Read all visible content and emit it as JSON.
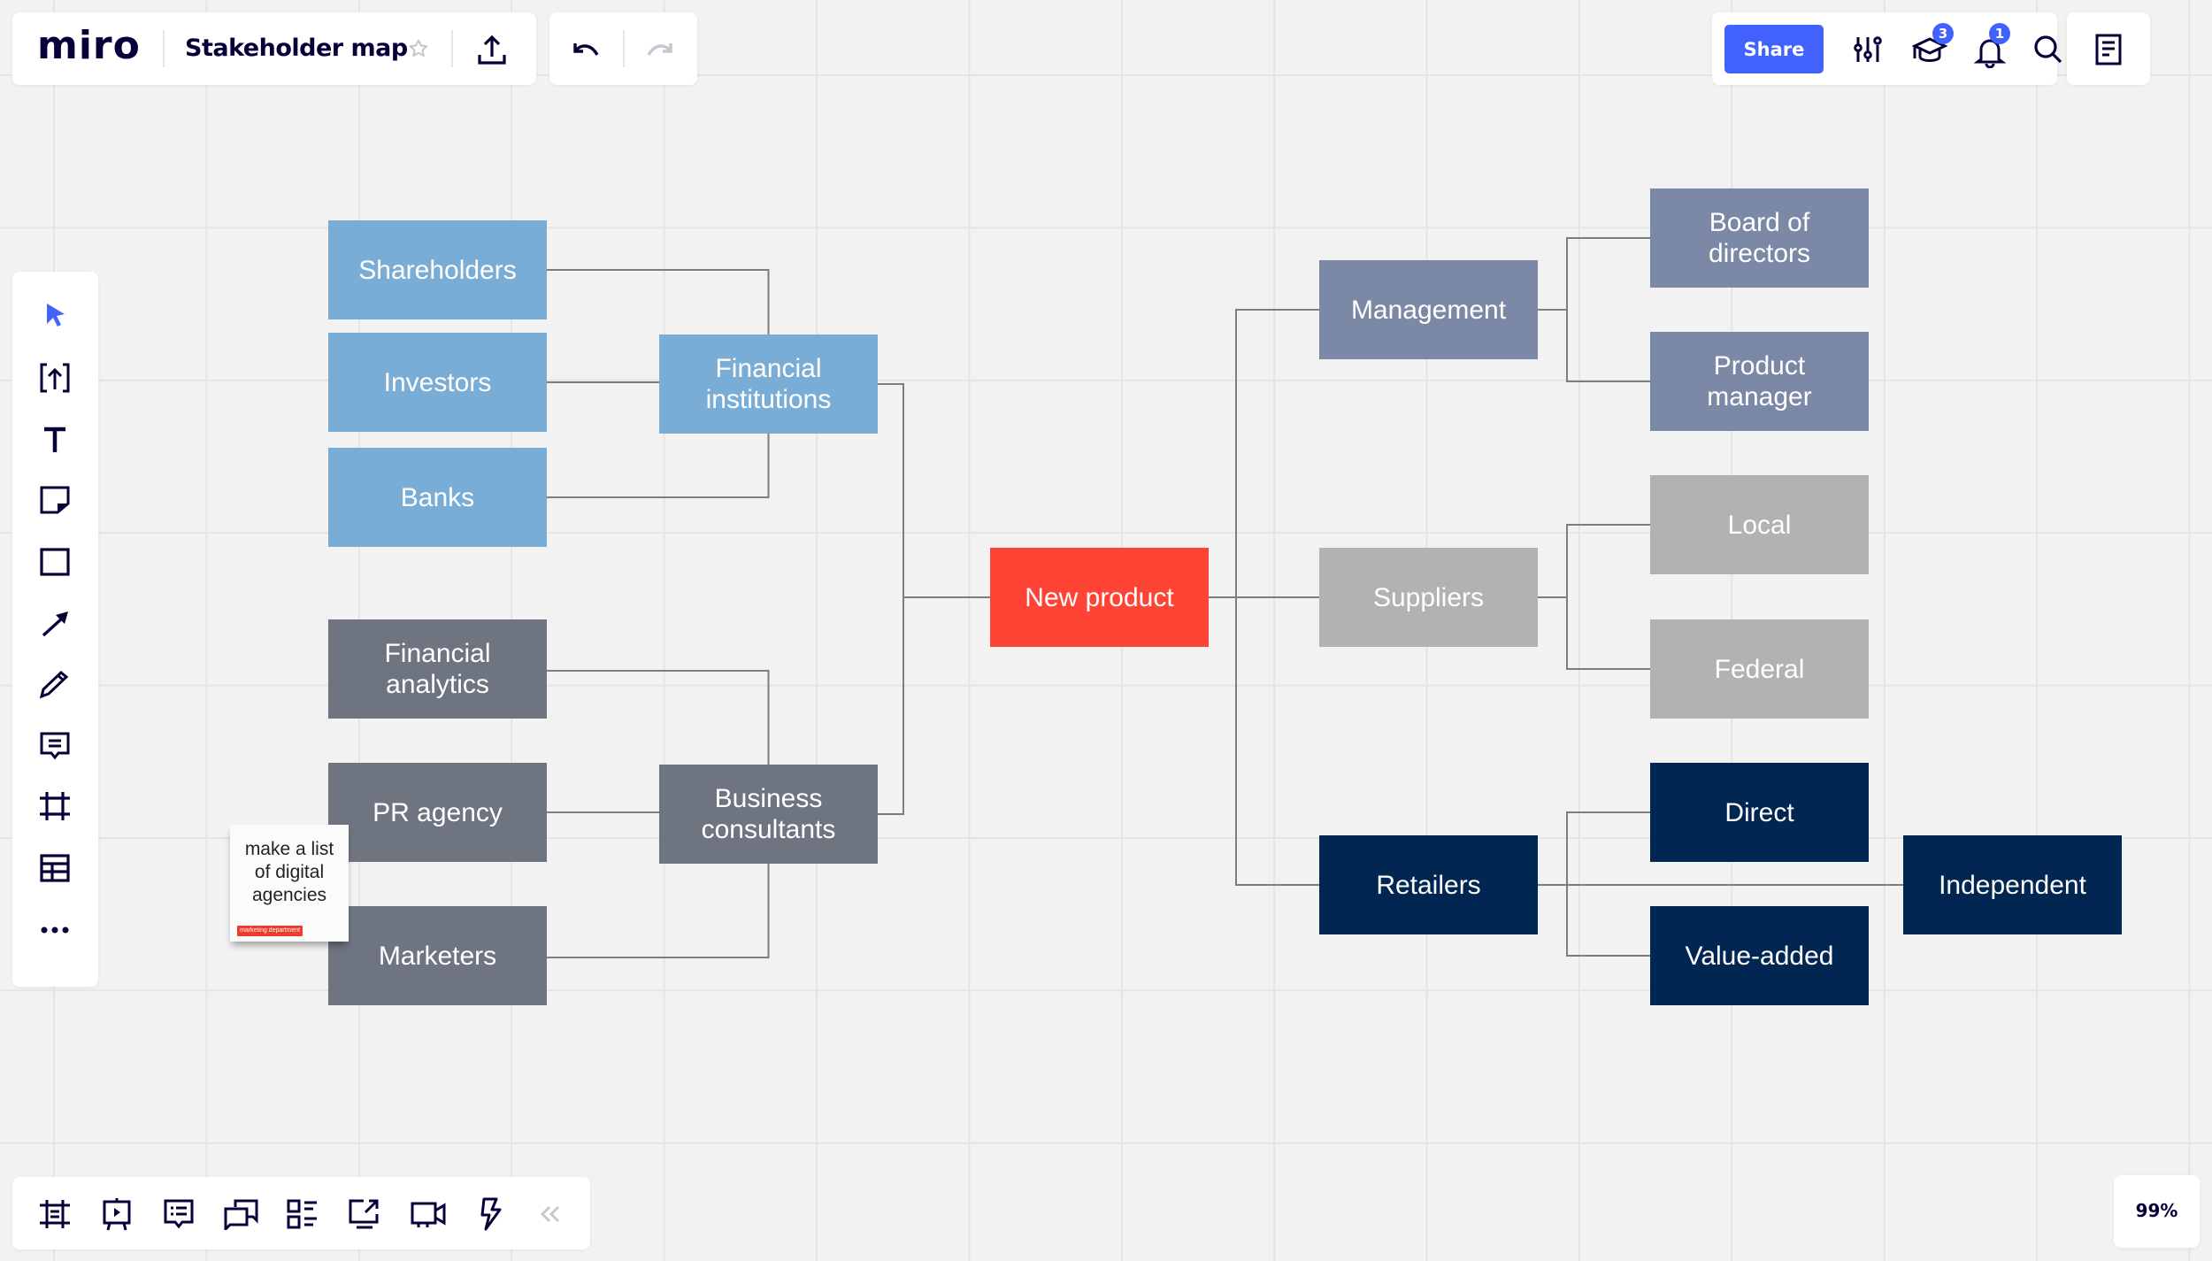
{
  "app": {
    "logo": "miro",
    "board_title": "Stakeholder map",
    "zoom_level": "99%"
  },
  "colors": {
    "accent": "#4262ff",
    "canvas": "#f2f2f2",
    "group_financial": "#7aadd6",
    "group_business": "#6f7580",
    "group_center": "#ff4335",
    "group_management": "#7b89a6",
    "group_suppliers": "#b2b2b2",
    "group_retailers": "#012651"
  },
  "top_left_toolbar": {
    "favorite_icon": "star-icon",
    "export_icon": "upload-icon",
    "undo_icon": "undo-icon",
    "redo_icon": "redo-icon"
  },
  "top_right_toolbar": {
    "share_label": "Share",
    "settings_icon": "sliders-icon",
    "learning_icon": "graduation-cap-icon",
    "learning_badge": "3",
    "notifications_icon": "bell-icon",
    "notifications_badge": "1",
    "search_icon": "search-icon",
    "board_menu_icon": "document-icon"
  },
  "left_toolbar": {
    "tools": [
      {
        "name": "select",
        "icon": "cursor-icon",
        "active": true
      },
      {
        "name": "upload",
        "icon": "upload-frame-icon"
      },
      {
        "name": "text",
        "icon": "text-icon"
      },
      {
        "name": "sticky-note",
        "icon": "sticky-note-icon"
      },
      {
        "name": "shape",
        "icon": "rectangle-icon"
      },
      {
        "name": "connection-line",
        "icon": "arrow-icon"
      },
      {
        "name": "pen",
        "icon": "pencil-icon"
      },
      {
        "name": "comment",
        "icon": "comment-icon"
      },
      {
        "name": "frame",
        "icon": "frame-icon"
      },
      {
        "name": "table",
        "icon": "table-icon"
      },
      {
        "name": "more",
        "icon": "more-icon"
      }
    ]
  },
  "bottom_toolbar": {
    "tools": [
      {
        "name": "frames",
        "icon": "frames-list-icon"
      },
      {
        "name": "presentation",
        "icon": "presentation-icon"
      },
      {
        "name": "comments",
        "icon": "comments-list-icon"
      },
      {
        "name": "chat",
        "icon": "chat-icon"
      },
      {
        "name": "cards",
        "icon": "cards-icon"
      },
      {
        "name": "screen-share",
        "icon": "screen-share-icon"
      },
      {
        "name": "video-call",
        "icon": "video-icon"
      },
      {
        "name": "activity",
        "icon": "lightning-icon"
      },
      {
        "name": "collapse",
        "icon": "double-chevron-left-icon"
      }
    ]
  },
  "diagram": {
    "nodes": [
      {
        "id": "shareholders",
        "label": "Shareholders",
        "group": "financial"
      },
      {
        "id": "investors",
        "label": "Investors",
        "group": "financial"
      },
      {
        "id": "banks",
        "label": "Banks",
        "group": "financial"
      },
      {
        "id": "financial_institutions",
        "label": "Financial\ninstitutions",
        "group": "financial"
      },
      {
        "id": "financial_analytics",
        "label": "Financial\nanalytics",
        "group": "business"
      },
      {
        "id": "pr_agency",
        "label": "PR agency",
        "group": "business"
      },
      {
        "id": "marketers",
        "label": "Marketers",
        "group": "business"
      },
      {
        "id": "business_consultants",
        "label": "Business\nconsultants",
        "group": "business"
      },
      {
        "id": "new_product",
        "label": "New product",
        "group": "center"
      },
      {
        "id": "management",
        "label": "Management",
        "group": "management"
      },
      {
        "id": "board_of_directors",
        "label": "Board of\ndirectors",
        "group": "management"
      },
      {
        "id": "product_manager",
        "label": "Product\nmanager",
        "group": "management"
      },
      {
        "id": "suppliers",
        "label": "Suppliers",
        "group": "suppliers"
      },
      {
        "id": "local",
        "label": "Local",
        "group": "suppliers"
      },
      {
        "id": "federal",
        "label": "Federal",
        "group": "suppliers"
      },
      {
        "id": "retailers",
        "label": "Retailers",
        "group": "retailers"
      },
      {
        "id": "direct",
        "label": "Direct",
        "group": "retailers"
      },
      {
        "id": "value_added",
        "label": "Value-added",
        "group": "retailers"
      },
      {
        "id": "independent",
        "label": "Independent",
        "group": "retailers"
      }
    ],
    "edges": [
      [
        "shareholders",
        "financial_institutions"
      ],
      [
        "investors",
        "financial_institutions"
      ],
      [
        "banks",
        "financial_institutions"
      ],
      [
        "financial_analytics",
        "business_consultants"
      ],
      [
        "pr_agency",
        "business_consultants"
      ],
      [
        "marketers",
        "business_consultants"
      ],
      [
        "financial_institutions",
        "new_product"
      ],
      [
        "business_consultants",
        "new_product"
      ],
      [
        "new_product",
        "management"
      ],
      [
        "new_product",
        "suppliers"
      ],
      [
        "new_product",
        "retailers"
      ],
      [
        "management",
        "board_of_directors"
      ],
      [
        "management",
        "product_manager"
      ],
      [
        "suppliers",
        "local"
      ],
      [
        "suppliers",
        "federal"
      ],
      [
        "retailers",
        "direct"
      ],
      [
        "retailers",
        "value_added"
      ],
      [
        "retailers",
        "independent"
      ]
    ]
  },
  "sticky_note": {
    "text": "make a list\nof digital\nagencies",
    "tag": "marketing department"
  }
}
